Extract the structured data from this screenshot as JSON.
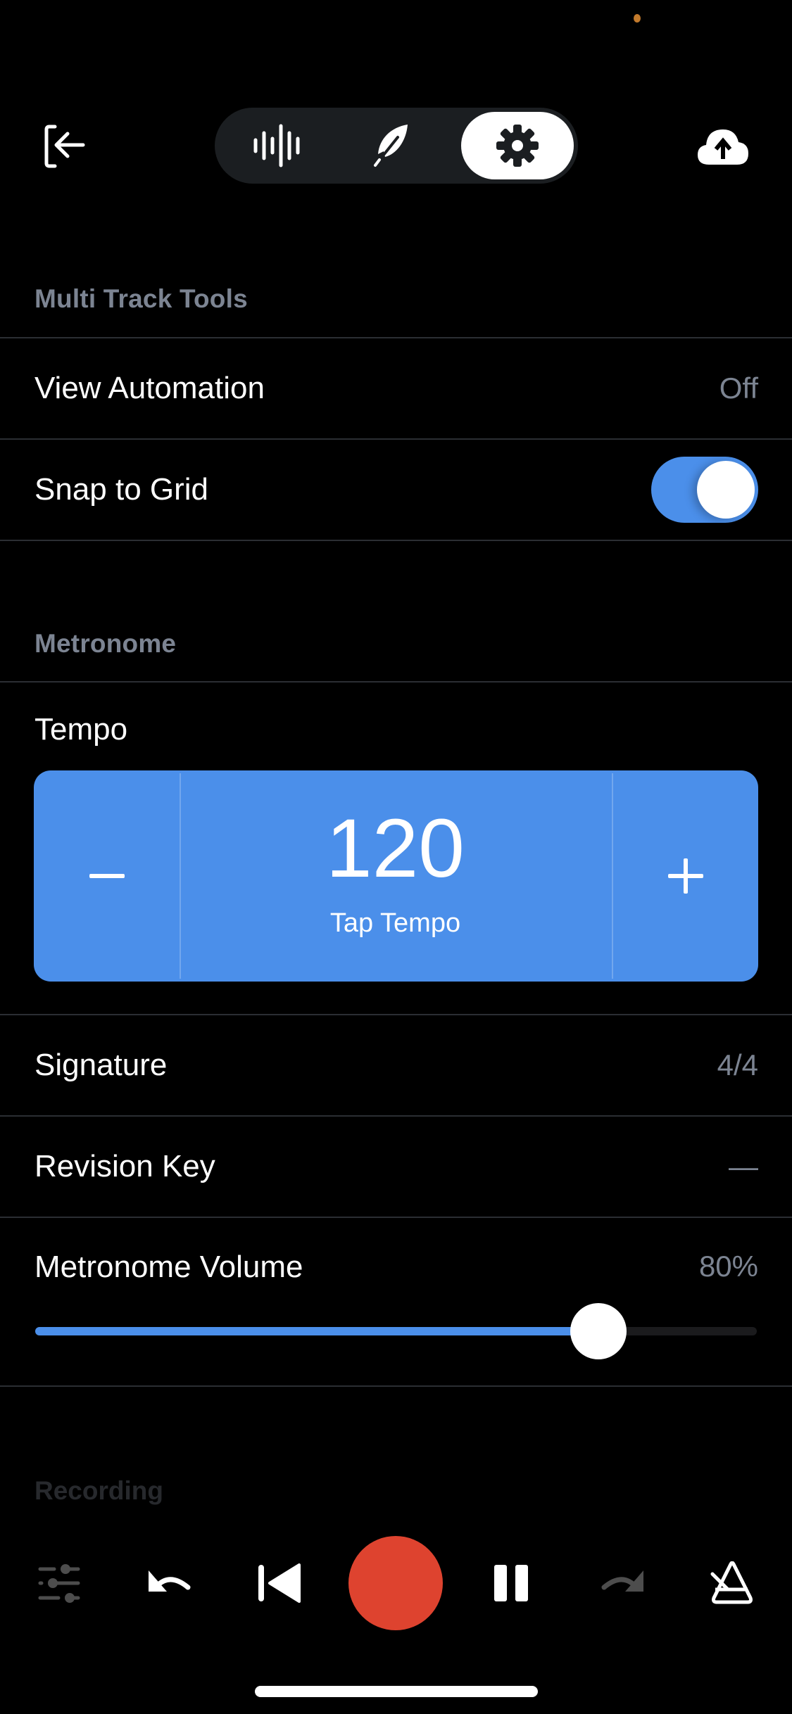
{
  "top_nav": {
    "exit_icon": "exit-arrow-icon",
    "segments": [
      {
        "name": "waveform",
        "icon": "waveform-icon",
        "selected": false
      },
      {
        "name": "feather",
        "icon": "feather-icon",
        "selected": false
      },
      {
        "name": "settings",
        "icon": "gear-icon",
        "selected": true
      }
    ],
    "upload_icon": "cloud-upload-icon"
  },
  "multi_track_tools": {
    "header": "Multi Track Tools",
    "view_automation": {
      "label": "View Automation",
      "value": "Off"
    },
    "snap_to_grid": {
      "label": "Snap to Grid",
      "enabled": true
    }
  },
  "metronome": {
    "header": "Metronome",
    "tempo": {
      "label": "Tempo",
      "value": "120",
      "tap_label": "Tap Tempo",
      "decrement_label": "−",
      "increment_label": "+"
    },
    "signature": {
      "label": "Signature",
      "value": "4/4"
    },
    "revision_key": {
      "label": "Revision Key",
      "value": "—"
    },
    "volume": {
      "label": "Metronome Volume",
      "value": "80%",
      "fraction": 0.78
    }
  },
  "recording": {
    "header": "Recording"
  },
  "bottom_bar": {
    "items": [
      {
        "name": "mixer",
        "icon": "sliders-icon",
        "enabled": false
      },
      {
        "name": "undo",
        "icon": "undo-icon",
        "enabled": true
      },
      {
        "name": "skip-back",
        "icon": "skip-back-icon",
        "enabled": true
      },
      {
        "name": "record",
        "icon": "record-icon",
        "enabled": true
      },
      {
        "name": "pause",
        "icon": "pause-icon",
        "enabled": true
      },
      {
        "name": "redo",
        "icon": "redo-icon",
        "enabled": false
      },
      {
        "name": "metronome",
        "icon": "metronome-icon",
        "enabled": true
      }
    ]
  },
  "colors": {
    "accent": "#4b8fea",
    "record": "#de432f",
    "secondary_text": "#7c8492",
    "background": "#000000",
    "status_dot": "#c27a2c"
  }
}
